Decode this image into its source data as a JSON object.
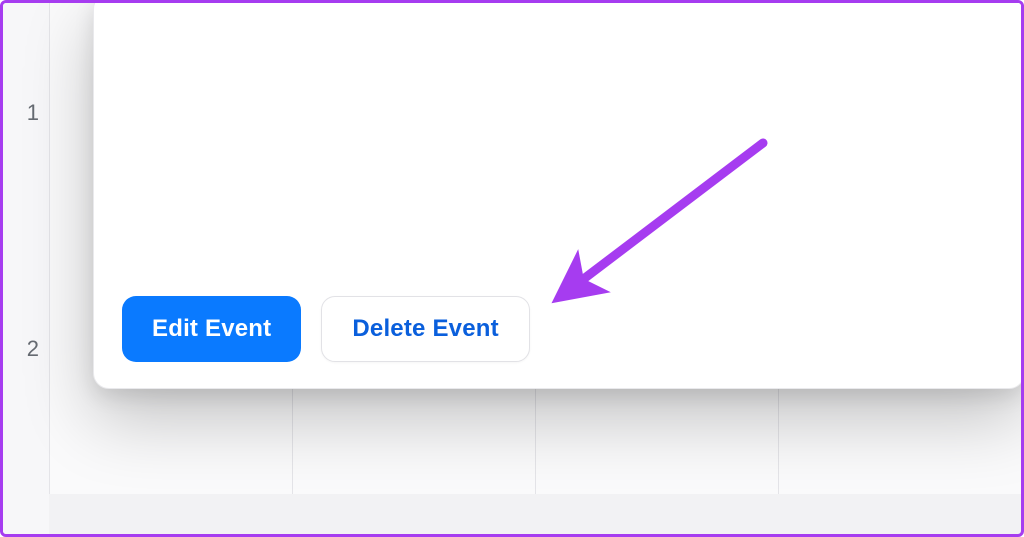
{
  "calendar": {
    "time_labels": [
      "1",
      "2"
    ]
  },
  "modal": {
    "buttons": {
      "edit_label": "Edit Event",
      "delete_label": "Delete Event"
    }
  },
  "annotation": {
    "arrow_color": "#a63cf0"
  }
}
